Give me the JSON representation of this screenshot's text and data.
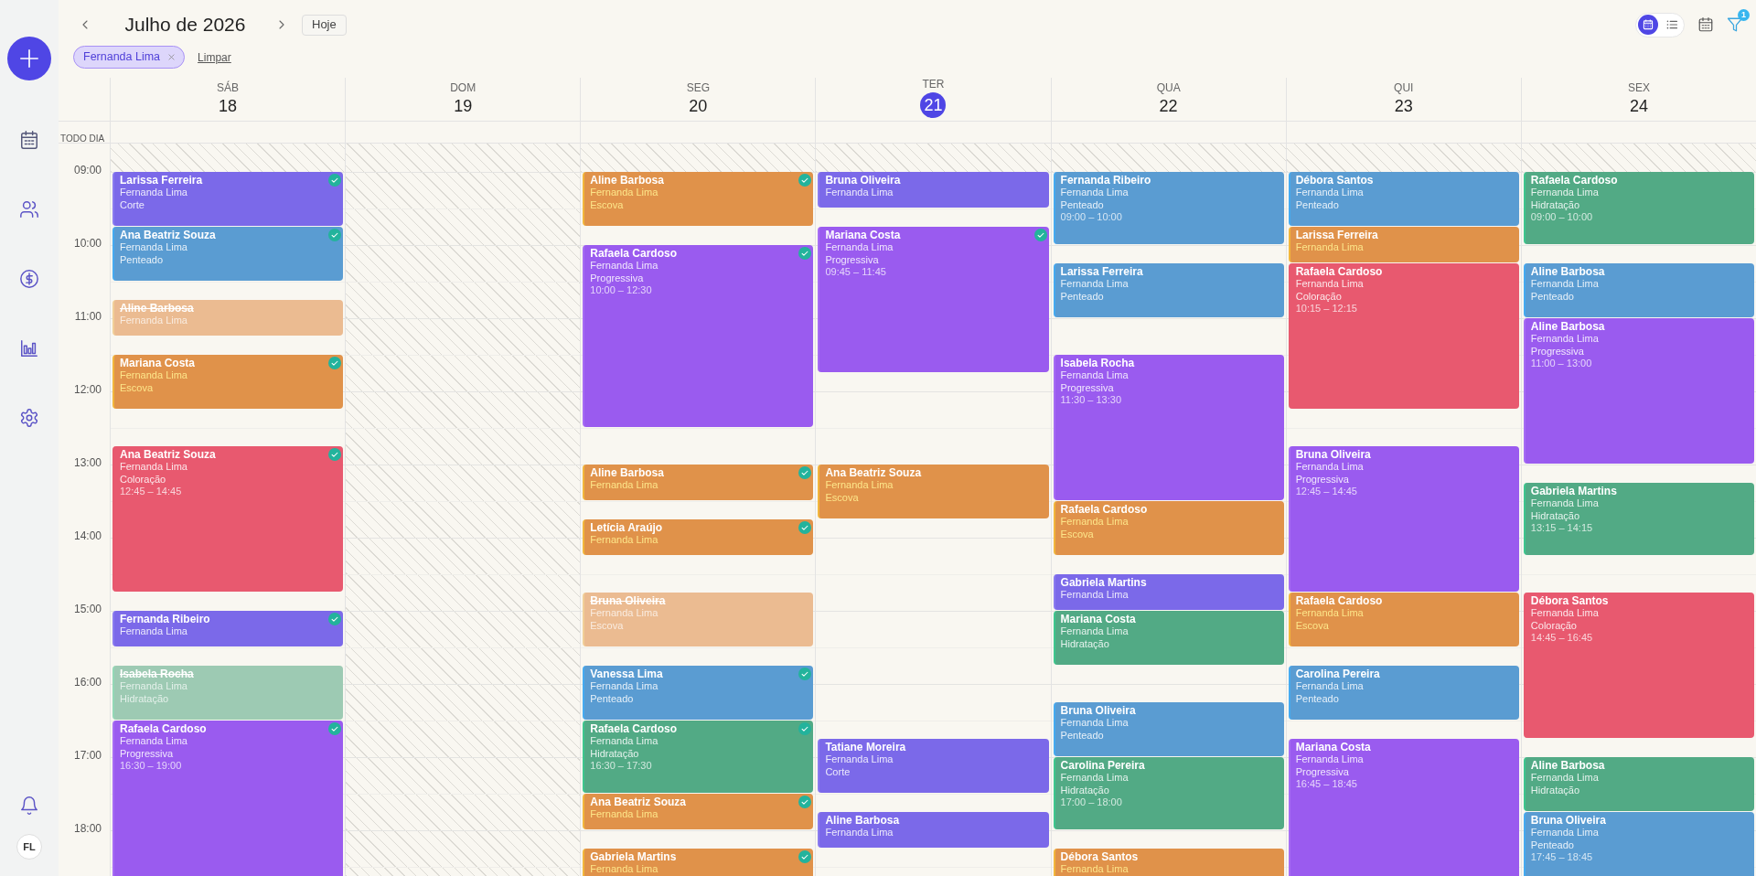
{
  "sidebar": {
    "avatar": "FL"
  },
  "header": {
    "title": "Julho de 2026",
    "today_button": "Hoje",
    "view_toggle": [
      {
        "kind": "calendar",
        "selected": true
      },
      {
        "kind": "list",
        "selected": false
      }
    ],
    "filter_badge": "1"
  },
  "filters": {
    "chips": [
      {
        "label": "Fernanda Lima"
      }
    ],
    "clear_link": "Limpar"
  },
  "calendar": {
    "all_day_label": "TODO DIA",
    "time_labels": [
      "09:00",
      "10:00",
      "11:00",
      "12:00",
      "13:00",
      "14:00",
      "15:00",
      "16:00",
      "17:00",
      "18:00"
    ],
    "days": [
      {
        "weekday": "SÁB",
        "date": "18",
        "today": false,
        "closed": false,
        "events": [
          {
            "client": "Larissa Ferreira",
            "professional": "Fernanda Lima",
            "service": "Corte",
            "color": "#7b69e9",
            "confirmed": true,
            "cancelled": false
          },
          {
            "client": "Ana Beatriz Souza",
            "professional": "Fernanda Lima",
            "service": "Penteado",
            "color": "#5a9cd2",
            "confirmed": true,
            "cancelled": false
          },
          {
            "client": "Aline Barbosa",
            "professional": "Fernanda Lima",
            "color": "#ebbb91",
            "confirmed": false,
            "cancelled": true
          },
          {
            "client": "Mariana Costa",
            "professional": "Fernanda Lima",
            "service": "Escova",
            "color": "#e0924a",
            "confirmed": true,
            "cancelled": false
          },
          {
            "client": "Ana Beatriz Souza",
            "professional": "Fernanda Lima",
            "service": "Coloração",
            "time": "12:45 – 14:45",
            "color": "#e8596f",
            "confirmed": true,
            "cancelled": false
          },
          {
            "client": "Fernanda Ribeiro",
            "professional": "Fernanda Lima",
            "color": "#7b69e9",
            "confirmed": true,
            "cancelled": false
          },
          {
            "client": "Isabela Rocha",
            "professional": "Fernanda Lima",
            "service": "Hidratação",
            "color": "#9dcab3",
            "confirmed": false,
            "cancelled": true
          },
          {
            "client": "Rafaela Cardoso",
            "professional": "Fernanda Lima",
            "service": "Progressiva",
            "time": "16:30 – 19:00",
            "color": "#9a5bef",
            "confirmed": true,
            "cancelled": false
          }
        ]
      },
      {
        "weekday": "DOM",
        "date": "19",
        "today": false,
        "closed": true
      },
      {
        "weekday": "SEG",
        "date": "20",
        "today": false,
        "closed": false,
        "events": [
          {
            "client": "Aline Barbosa",
            "professional": "Fernanda Lima",
            "service": "Escova",
            "color": "#e0924a",
            "confirmed": true,
            "cancelled": false
          },
          {
            "client": "Rafaela Cardoso",
            "professional": "Fernanda Lima",
            "service": "Progressiva",
            "time": "10:00 – 12:30",
            "color": "#9a5bef",
            "confirmed": true,
            "cancelled": false
          },
          {
            "client": "Aline Barbosa",
            "professional": "Fernanda Lima",
            "color": "#e0924a",
            "confirmed": true,
            "cancelled": false
          },
          {
            "client": "Letícia Araújo",
            "professional": "Fernanda Lima",
            "color": "#e0924a",
            "confirmed": true,
            "cancelled": false
          },
          {
            "client": "Bruna Oliveira",
            "professional": "Fernanda Lima",
            "service": "Escova",
            "color": "#ebbb91",
            "confirmed": false,
            "cancelled": true
          },
          {
            "client": "Vanessa Lima",
            "professional": "Fernanda Lima",
            "service": "Penteado",
            "color": "#5a9cd2",
            "confirmed": true,
            "cancelled": false
          },
          {
            "client": "Rafaela Cardoso",
            "professional": "Fernanda Lima",
            "service": "Hidratação",
            "time": "16:30 – 17:30",
            "color": "#52aa85",
            "confirmed": true,
            "cancelled": false
          },
          {
            "client": "Ana Beatriz Souza",
            "professional": "Fernanda Lima",
            "color": "#e0924a",
            "confirmed": true,
            "cancelled": false
          },
          {
            "client": "Gabriela Martins",
            "professional": "Fernanda Lima",
            "color": "#e0924a",
            "confirmed": true,
            "cancelled": false
          }
        ]
      },
      {
        "weekday": "TER",
        "date": "21",
        "today": true,
        "closed": false,
        "events": [
          {
            "client": "Bruna Oliveira",
            "professional": "Fernanda Lima",
            "color": "#7b69e9",
            "confirmed": false,
            "cancelled": false
          },
          {
            "client": "Mariana Costa",
            "professional": "Fernanda Lima",
            "service": "Progressiva",
            "time": "09:45 – 11:45",
            "color": "#9a5bef",
            "confirmed": true,
            "cancelled": false
          },
          {
            "client": "Ana Beatriz Souza",
            "professional": "Fernanda Lima",
            "service": "Escova",
            "color": "#e0924a",
            "confirmed": false,
            "cancelled": false
          },
          {
            "client": "Tatiane Moreira",
            "professional": "Fernanda Lima",
            "service": "Corte",
            "color": "#7b69e9",
            "confirmed": false,
            "cancelled": false
          },
          {
            "client": "Aline Barbosa",
            "professional": "Fernanda Lima",
            "color": "#7b69e9",
            "confirmed": false,
            "cancelled": false
          }
        ]
      },
      {
        "weekday": "QUA",
        "date": "22",
        "today": false,
        "closed": false,
        "events": [
          {
            "client": "Fernanda Ribeiro",
            "professional": "Fernanda Lima",
            "service": "Penteado",
            "time": "09:00 – 10:00",
            "color": "#5a9cd2",
            "confirmed": false,
            "cancelled": false
          },
          {
            "client": "Larissa Ferreira",
            "professional": "Fernanda Lima",
            "service": "Penteado",
            "color": "#5a9cd2",
            "confirmed": false,
            "cancelled": false
          },
          {
            "client": "Isabela Rocha",
            "professional": "Fernanda Lima",
            "service": "Progressiva",
            "time": "11:30 – 13:30",
            "color": "#9a5bef",
            "confirmed": false,
            "cancelled": false
          },
          {
            "client": "Rafaela Cardoso",
            "professional": "Fernanda Lima",
            "service": "Escova",
            "color": "#e0924a",
            "confirmed": false,
            "cancelled": false
          },
          {
            "client": "Gabriela Martins",
            "professional": "Fernanda Lima",
            "color": "#7b69e9",
            "confirmed": false,
            "cancelled": false
          },
          {
            "client": "Mariana Costa",
            "professional": "Fernanda Lima",
            "service": "Hidratação",
            "color": "#52aa85",
            "confirmed": false,
            "cancelled": false
          },
          {
            "client": "Bruna Oliveira",
            "professional": "Fernanda Lima",
            "service": "Penteado",
            "color": "#5a9cd2",
            "confirmed": false,
            "cancelled": false
          },
          {
            "client": "Carolina Pereira",
            "professional": "Fernanda Lima",
            "service": "Hidratação",
            "time": "17:00 – 18:00",
            "color": "#52aa85",
            "confirmed": false,
            "cancelled": false
          },
          {
            "client": "Débora Santos",
            "professional": "Fernanda Lima",
            "color": "#e0924a",
            "confirmed": false,
            "cancelled": false
          }
        ]
      },
      {
        "weekday": "QUI",
        "date": "23",
        "today": false,
        "closed": false,
        "events": [
          {
            "client": "Débora Santos",
            "professional": "Fernanda Lima",
            "service": "Penteado",
            "color": "#5a9cd2",
            "confirmed": false,
            "cancelled": false
          },
          {
            "client": "Larissa Ferreira",
            "professional": "Fernanda Lima",
            "color": "#e0924a",
            "confirmed": false,
            "cancelled": false
          },
          {
            "client": "Rafaela Cardoso",
            "professional": "Fernanda Lima",
            "service": "Coloração",
            "time": "10:15 – 12:15",
            "color": "#e8596f",
            "confirmed": false,
            "cancelled": false
          },
          {
            "client": "Bruna Oliveira",
            "professional": "Fernanda Lima",
            "service": "Progressiva",
            "time": "12:45 – 14:45",
            "color": "#9a5bef",
            "confirmed": false,
            "cancelled": false
          },
          {
            "client": "Rafaela Cardoso",
            "professional": "Fernanda Lima",
            "service": "Escova",
            "color": "#e0924a",
            "confirmed": false,
            "cancelled": false
          },
          {
            "client": "Carolina Pereira",
            "professional": "Fernanda Lima",
            "service": "Penteado",
            "color": "#5a9cd2",
            "confirmed": false,
            "cancelled": false
          },
          {
            "client": "Mariana Costa",
            "professional": "Fernanda Lima",
            "service": "Progressiva",
            "time": "16:45 – 18:45",
            "color": "#9a5bef",
            "confirmed": false,
            "cancelled": false
          }
        ]
      },
      {
        "weekday": "SEX",
        "date": "24",
        "today": false,
        "closed": false,
        "events": [
          {
            "client": "Rafaela Cardoso",
            "professional": "Fernanda Lima",
            "service": "Hidratação",
            "time": "09:00 – 10:00",
            "color": "#52aa85",
            "confirmed": false,
            "cancelled": false
          },
          {
            "client": "Aline Barbosa",
            "professional": "Fernanda Lima",
            "service": "Penteado",
            "color": "#5a9cd2",
            "confirmed": false,
            "cancelled": false
          },
          {
            "client": "Aline Barbosa",
            "professional": "Fernanda Lima",
            "service": "Progressiva",
            "time": "11:00 – 13:00",
            "color": "#9a5bef",
            "confirmed": false,
            "cancelled": false
          },
          {
            "client": "Gabriela Martins",
            "professional": "Fernanda Lima",
            "service": "Hidratação",
            "time": "13:15 – 14:15",
            "color": "#52aa85",
            "confirmed": false,
            "cancelled": false
          },
          {
            "client": "Débora Santos",
            "professional": "Fernanda Lima",
            "service": "Coloração",
            "time": "14:45 – 16:45",
            "color": "#e8596f",
            "confirmed": false,
            "cancelled": false
          },
          {
            "client": "Aline Barbosa",
            "professional": "Fernanda Lima",
            "service": "Hidratação",
            "color": "#52aa85",
            "confirmed": false,
            "cancelled": false
          },
          {
            "client": "Bruna Oliveira",
            "professional": "Fernanda Lima",
            "service": "Penteado",
            "time": "17:45 – 18:45",
            "color": "#5a9cd2",
            "confirmed": false,
            "cancelled": false
          }
        ]
      }
    ]
  }
}
